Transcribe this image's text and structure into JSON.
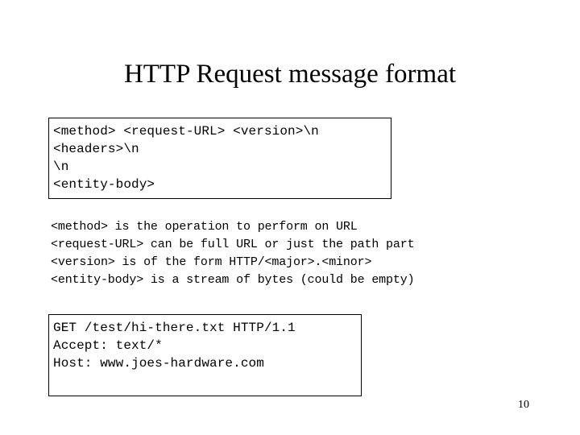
{
  "slide": {
    "title": "HTTP Request message format",
    "page_number": "10",
    "background_color": "#ffffff",
    "text_color": "#000000",
    "border_color": "#000000"
  },
  "format_box": {
    "lines": [
      "<method> <request-URL> <version>\\n",
      "<headers>\\n",
      "\\n",
      "<entity-body>"
    ]
  },
  "description_block": {
    "lines": [
      "<method> is the operation to perform on URL",
      "<request-URL> can be full URL or just the path part",
      "<version> is of the form HTTP/<major>.<minor>",
      "<entity-body> is a stream of bytes (could be empty)"
    ]
  },
  "example_box": {
    "lines": [
      "GET /test/hi-there.txt HTTP/1.1",
      "Accept: text/*",
      "Host: www.joes-hardware.com"
    ]
  }
}
